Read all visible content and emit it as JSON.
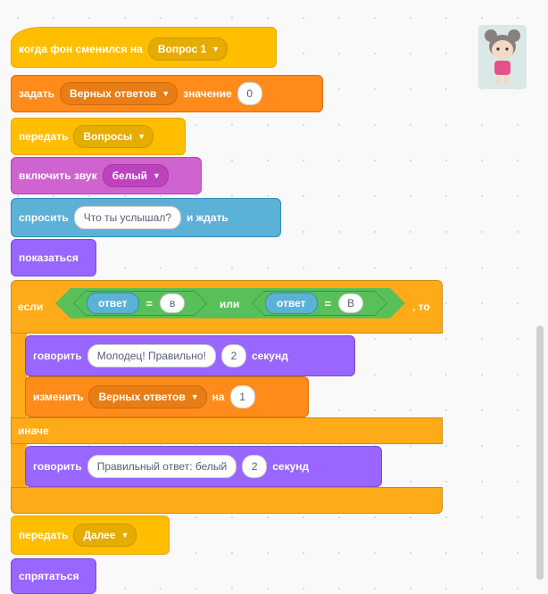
{
  "colors": {
    "events": "#ffbf00",
    "variables": "#ff8c1a",
    "sound": "#cf63cf",
    "sensing": "#5cb1d6",
    "looks": "#9966ff",
    "control": "#ffab19",
    "operators": "#59c059"
  },
  "sprite_thumbnail": {
    "icon": "girl-sprite-icon"
  },
  "blocks": {
    "when_backdrop": {
      "label": "когда фон сменился на",
      "backdrop": "Вопрос 1"
    },
    "set_var": {
      "label": "задать",
      "variable": "Верных ответов",
      "value_label": "значение",
      "value": "0"
    },
    "broadcast1": {
      "label": "передать",
      "message": "Вопросы"
    },
    "start_sound": {
      "label": "включить звук",
      "sound": "белый"
    },
    "ask": {
      "label": "спросить",
      "question": "Что ты услышал?",
      "suffix": "и ждать"
    },
    "show": {
      "label": "показаться"
    },
    "if_else": {
      "if_label": "если",
      "then_label": ", то",
      "else_label": "иначе",
      "or_label": "или",
      "left_compare": {
        "reporter": "ответ",
        "op": "=",
        "value": "в"
      },
      "right_compare": {
        "reporter": "ответ",
        "op": "=",
        "value": "В"
      }
    },
    "say_correct": {
      "label": "говорить",
      "text": "Молодец! Правильно!",
      "secs": "2",
      "secs_label": "секунд"
    },
    "change_var": {
      "label": "изменить",
      "variable": "Верных ответов",
      "by_label": "на",
      "value": "1"
    },
    "say_wrong": {
      "label": "говорить",
      "text": "Правильный ответ: белый",
      "secs": "2",
      "secs_label": "секунд"
    },
    "broadcast2": {
      "label": "передать",
      "message": "Далее"
    },
    "hide": {
      "label": "спрятаться"
    }
  }
}
